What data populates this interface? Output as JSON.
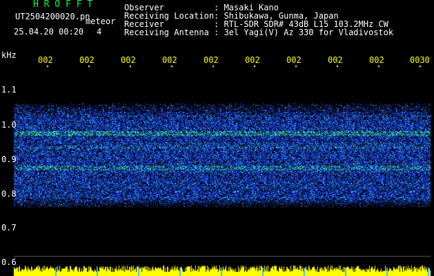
{
  "header": {
    "brand": "H R O F F T",
    "filename": "UT2504200020.pn",
    "meteor_label": "meteor",
    "datetime": "25.04.20 00:20",
    "count": "4",
    "fields": [
      {
        "label": "Observer",
        "value": ": Masaki Kano"
      },
      {
        "label": "Receiving Location",
        "value": ": Shibukawa, Gunma, Japan"
      },
      {
        "label": "Receiver",
        "value": ": RTL-SDR SDR# 43dB L15 103.2MHz CW"
      },
      {
        "label": "Receiving Antenna",
        "value": ": 3el Yagi(V) Az 330 for Vladivostok"
      }
    ]
  },
  "axis": {
    "unit": "kHz",
    "y_ticks": [
      "1.1",
      "1.0",
      "0.9",
      "0.8",
      "0.7",
      "0.6"
    ],
    "time_ticks": [
      "002",
      "002",
      "002",
      "002",
      "002",
      "002",
      "002",
      "002",
      "002",
      "0030"
    ]
  },
  "colors": {
    "text": "#ffffff",
    "time_labels": "#ffff00",
    "brand": "#00ff40",
    "signal_band": "#ffff00",
    "spectrum_low": "#000080",
    "spectrum_high": "#00ff80"
  }
}
